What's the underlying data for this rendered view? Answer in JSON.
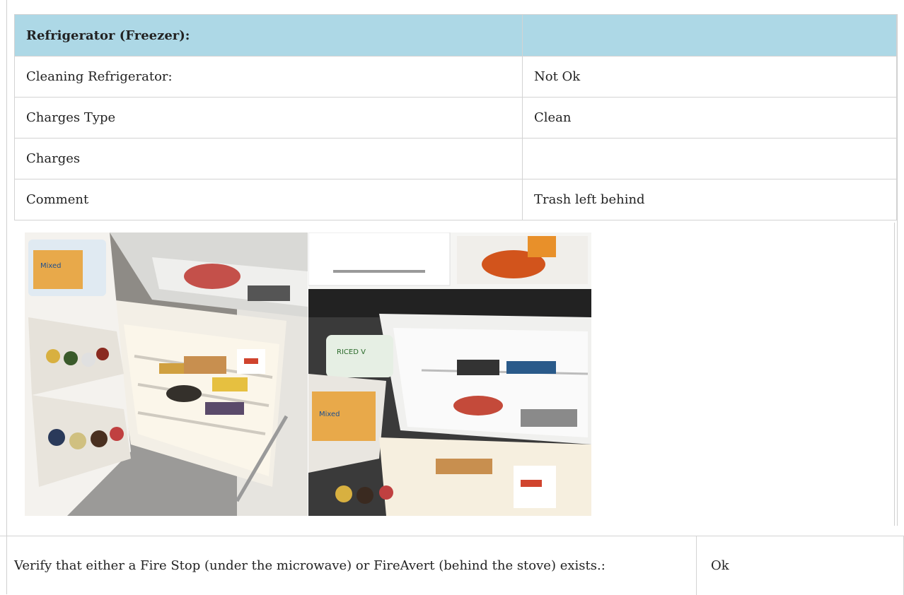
{
  "section": {
    "title": "Refrigerator (Freezer):",
    "title_value": "",
    "rows": [
      {
        "label": "Cleaning Refrigerator:",
        "value": "Not Ok"
      },
      {
        "label": "Charges Type",
        "value": "Clean"
      },
      {
        "label": "Charges",
        "value": ""
      },
      {
        "label": "Comment",
        "value": "Trash left behind"
      }
    ],
    "photos": [
      {
        "name": "open-refrigerator-photo"
      },
      {
        "name": "freezer-drawer-photo"
      }
    ]
  },
  "next_item": {
    "question": "Verify that either a Fire Stop (under the microwave) or FireAvert (behind the stove) exists.:",
    "answer": "Ok"
  }
}
